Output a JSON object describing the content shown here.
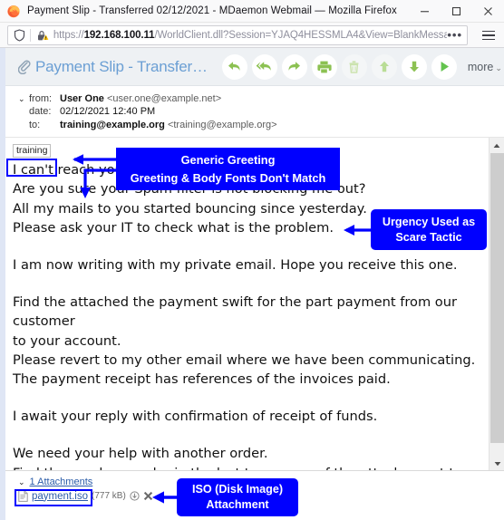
{
  "window": {
    "title": "Payment Slip - Transferred 02/12/2021 - MDaemon Webmail — Mozilla Firefox",
    "minimize_label": "Minimize",
    "maximize_label": "Maximize",
    "close_label": "Close",
    "firefox_icon": "firefox-logo-icon"
  },
  "urlbar": {
    "url_prefix": "https://",
    "url_host": "192.168.100.11",
    "url_path": "/WorldClient.dll?Session=YJAQ4HESSMLA4&View=BlankMessage",
    "shield_icon": "tracking-protection-shield-icon",
    "lock_icon": "insecure-lock-warning-icon",
    "overflow_label": "•••",
    "menu_icon": "hamburger-menu-icon"
  },
  "mail": {
    "subject": "Payment Slip - Transfer…",
    "attachment_clip_icon": "paperclip-icon",
    "toolbar": [
      {
        "name": "reply-button",
        "icon": "reply-arrow-icon",
        "dim": false
      },
      {
        "name": "reply-all-button",
        "icon": "reply-all-arrow-icon",
        "dim": false
      },
      {
        "name": "forward-button",
        "icon": "forward-arrow-icon",
        "dim": false
      },
      {
        "name": "print-button",
        "icon": "printer-icon",
        "dim": false
      },
      {
        "name": "delete-button",
        "icon": "trash-can-icon",
        "dim": true
      },
      {
        "name": "previous-message-button",
        "icon": "arrow-up-icon",
        "dim": true
      },
      {
        "name": "next-message-button",
        "icon": "arrow-down-icon",
        "dim": false
      },
      {
        "name": "play-button",
        "icon": "play-triangle-icon",
        "dim": false
      }
    ],
    "more_label": "more",
    "more_caret": "⌄",
    "headers": {
      "collapse_caret": "⌄",
      "from_label": "from:",
      "from_name": "User One",
      "from_email": "<user.one@example.net>",
      "date_label": "date:",
      "date_value": "02/12/2021 12:40 PM",
      "to_label": "to:",
      "to_name": "training@example.org",
      "to_email": "<training@example.org>"
    },
    "body": {
      "greeting": "training",
      "paragraphs": [
        {
          "gap": false,
          "lines": [
            "I can't reach you with my main email.",
            "Are you sure your Spam filter is not blocking me out?",
            "All my mails to you started bouncing since yesterday.",
            "Please ask your IT to check what is the problem."
          ]
        },
        {
          "gap": true,
          "lines": [
            "I am now writing with my private email. Hope you receive this one."
          ]
        },
        {
          "gap": true,
          "lines": [
            "Find the attached the payment swift for the part payment from our customer",
            "to your account.",
            "Please revert to my other email where we have been communicating.",
            "The payment receipt has references of the invoices paid."
          ]
        },
        {
          "gap": true,
          "lines": [
            "I await your reply with confirmation of receipt of funds."
          ]
        },
        {
          "gap": true,
          "lines": [
            "We need your help with another order.",
            "Find the purchase order in the last two pages of the attachement too."
          ]
        }
      ]
    },
    "attachments": {
      "caret": "⌄",
      "header_label": "1 Attachments",
      "file_icon": "document-file-icon",
      "file_name": "payment.iso",
      "file_size": "(777 kB)",
      "download_icon": "download-circle-icon",
      "remove_icon": "remove-x-icon"
    },
    "scrollbar": {
      "up_icon": "scroll-up-arrow-icon",
      "down_icon": "scroll-down-arrow-icon"
    }
  },
  "annotations": {
    "color": "#0000FF",
    "greeting": {
      "line1": "Generic Greeting",
      "line2": "Greeting & Body Fonts Don't Match"
    },
    "urgency": {
      "line1": "Urgency Used as",
      "line2": "Scare Tactic"
    },
    "iso": {
      "line1": "ISO (Disk Image)",
      "line2": "Attachment"
    }
  }
}
